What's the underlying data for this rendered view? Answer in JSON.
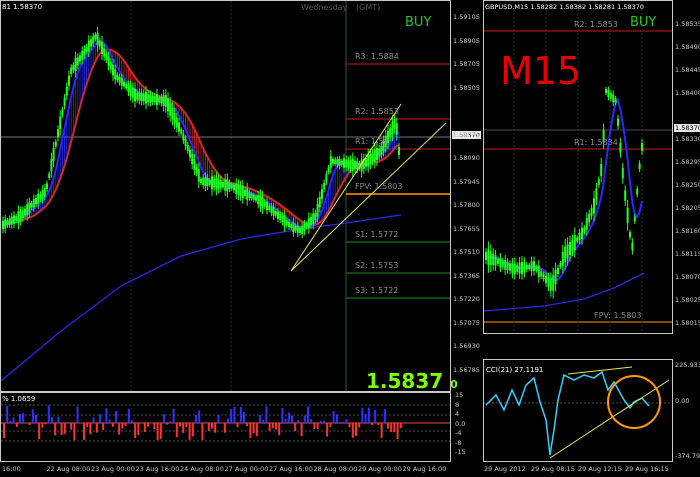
{
  "left_chart": {
    "header": "81 1.58370",
    "day_label": "Wednesday",
    "tz_label": "(GMT)",
    "signal": "BUY",
    "big_price": "1.5837",
    "big_price_suffix": "0",
    "levels": [
      {
        "label": "R3: 1.5884",
        "color": "#c81e1e"
      },
      {
        "label": "R2: 1.5853",
        "color": "#c81e1e"
      },
      {
        "label": "R1: 1.58",
        "color": "#c81e1e"
      },
      {
        "label": "FPV: 1.5803",
        "color": "#ff9900"
      },
      {
        "label": "S1: 1.5772",
        "color": "#1e8c1e"
      },
      {
        "label": "S2: 1.5753",
        "color": "#1e8c1e"
      },
      {
        "label": "S3: 1.5722",
        "color": "#1e8c1e"
      }
    ],
    "price_axis": [
      "1.59105",
      "1.58905",
      "1.58705",
      "1.58505",
      "1.58370",
      "1.58235",
      "1.58090",
      "1.57945",
      "1.57800",
      "1.57655",
      "1.57510",
      "1.57365",
      "1.57220",
      "1.57075",
      "1.56930",
      "1.56785"
    ],
    "current_price": "1.58370",
    "indicator": {
      "label": "% 1.0659",
      "axis": [
        "15",
        "8",
        "4",
        "0.0",
        "-4",
        "-8",
        "-15"
      ]
    },
    "time_axis": [
      "16:00",
      "22 Aug 08:00",
      "23 Aug 00:00",
      "23 Aug 16:00",
      "24 Aug 08:00",
      "27 Aug 00:00",
      "27 Aug 16:00",
      "28 Aug 08:00",
      "29 Aug 00:00",
      "29 Aug 16:00"
    ]
  },
  "right_chart": {
    "header": "GBPUSD,M15  1.58282 1.58382 1.58281 1.58370",
    "timeframe": "M15",
    "signal": "BUY",
    "levels": [
      {
        "label": "R2: 1.5853",
        "color": "#c81e1e"
      },
      {
        "label": "R1: 1.5834",
        "color": "#c81e1e"
      },
      {
        "label": "FPV: 1.5803",
        "color": "#ff9900"
      }
    ],
    "price_axis": [
      "1.58535",
      "1.58490",
      "1.58445",
      "1.58400",
      "1.58370",
      "1.58330",
      "1.58295",
      "1.58250",
      "1.58205",
      "1.58160",
      "1.58115",
      "1.58070",
      "1.58025",
      "1.58015"
    ],
    "current_price": "1.58370",
    "indicator": {
      "label": "CCI(21) 27.1191",
      "axis": [
        "225.933",
        "0.00",
        "-374.795"
      ]
    },
    "time_axis": [
      "29 Aug 2012",
      "29 Aug 08:15",
      "29 Aug 12:15",
      "29 Aug 16:15"
    ]
  },
  "colors": {
    "bull_candle": "#22ff22",
    "bear_candle": "#22ff22",
    "ma_fast": "#1e1eff",
    "ma_slow": "#c81e1e",
    "signal_text": "#1ec81e",
    "timeframe_text": "#e60000",
    "big_price": "#7cff00",
    "annotation_circle": "#ff9900",
    "trendline": "#e6e64b"
  }
}
